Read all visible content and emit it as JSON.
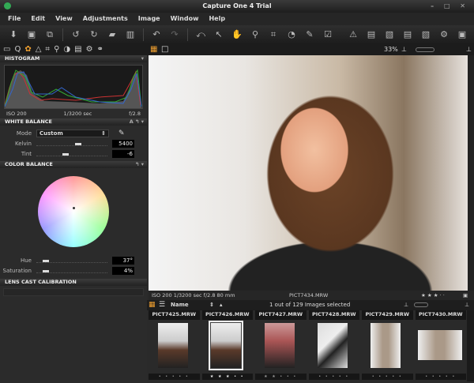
{
  "window": {
    "title": "Capture One 4 Trial",
    "controls": "– □ ✕"
  },
  "menu": [
    "File",
    "Edit",
    "View",
    "Adjustments",
    "Image",
    "Window",
    "Help"
  ],
  "toolbar_icons": [
    "import-icon",
    "capture-icon",
    "export-icon",
    "rotate-left-icon",
    "rotate-right-icon",
    "move-to-folder-icon",
    "trash-icon",
    "undo-icon",
    "redo-icon",
    "reset-icon",
    "select-cursor-icon",
    "pan-hand-icon",
    "zoom-icon",
    "crop-icon",
    "straighten-icon",
    "picker-icon",
    "keystone-icon",
    "warning-icon",
    "process-icon",
    "process-check-icon",
    "variant-icon",
    "variant-check-icon",
    "settings-icon",
    "fullscreen-icon"
  ],
  "viewer_toolbar": {
    "zoom": "33%"
  },
  "histogram": {
    "title": "HISTOGRAM",
    "iso": "ISO 200",
    "shutter": "1/3200 sec",
    "aperture": "f/2.8"
  },
  "white_balance": {
    "title": "WHITE BALANCE",
    "mode_label": "Mode",
    "mode_value": "Custom",
    "kelvin_label": "Kelvin",
    "kelvin_value": "5400",
    "tint_label": "Tint",
    "tint_value": "-6",
    "kelvin_pos": 0.6,
    "tint_pos": 0.4
  },
  "color_balance": {
    "title": "COLOR BALANCE",
    "hue_label": "Hue",
    "hue_value": "37°",
    "saturation_label": "Saturation",
    "saturation_value": "4%",
    "hue_pos": 0.1,
    "sat_pos": 0.1
  },
  "lens_cast": {
    "title": "LENS CAST CALIBRATION"
  },
  "infobar": {
    "exif": "ISO 200   1/3200 sec   f/2.8   80 mm",
    "filename": "PICT7434.MRW",
    "rating": "★ ★ ★ · ·"
  },
  "browser": {
    "sort": "Name",
    "status": "1 out of 129 Images selected",
    "files": [
      "PICT7425.MRW",
      "PICT7426.MRW",
      "PICT7427.MRW",
      "PICT7428.MRW",
      "PICT7429.MRW",
      "PICT7430.MRW"
    ],
    "ratings": [
      "• • • • •",
      "★ ★ ★ • •",
      "★ ★ • • •",
      "• • • • •",
      "• • • • •",
      "• • • • •"
    ],
    "selected_index": 1
  }
}
